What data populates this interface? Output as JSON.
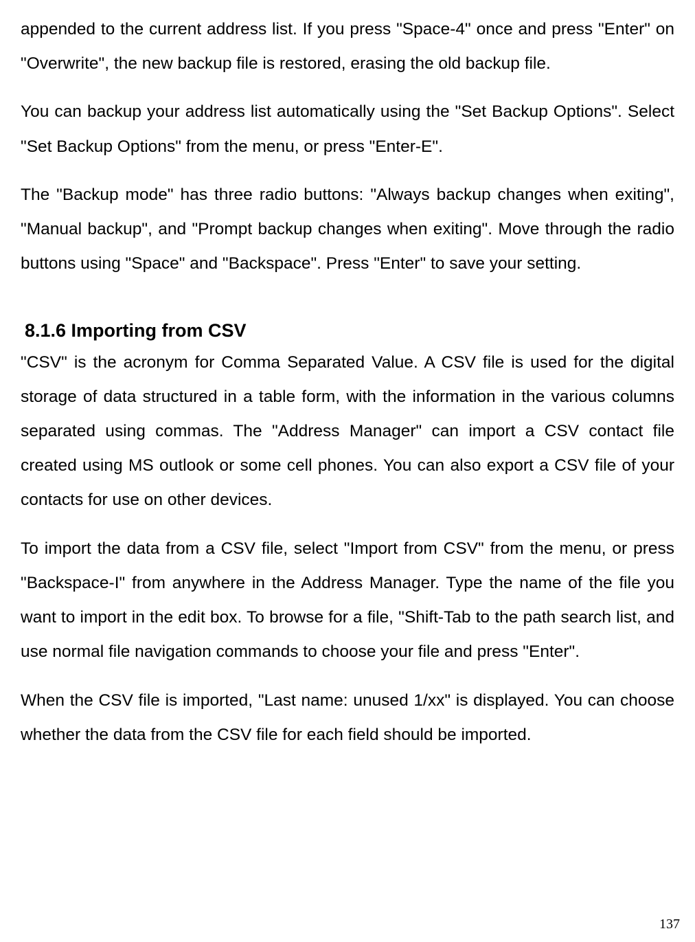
{
  "paragraphs": {
    "p1": "appended to the current address list. If you press \"Space-4\" once and press \"Enter\" on \"Overwrite\", the new backup file is restored, erasing the old backup file.",
    "p2": "You can backup your address list automatically using the \"Set Backup Options\". Select \"Set Backup Options\" from the menu, or press \"Enter-E\".",
    "p3": "The \"Backup mode\" has three radio buttons: \"Always backup changes when exiting\", \"Manual backup\", and \"Prompt backup changes when exiting\". Move through the radio buttons using \"Space\" and \"Backspace\". Press \"Enter\" to save your setting.",
    "heading": "8.1.6 Importing from CSV",
    "p4": "\"CSV\" is the acronym for Comma Separated Value. A CSV file is used for the digital storage of data structured in a table form, with the information in the various columns separated using commas. The \"Address Manager\" can import a CSV contact file created using MS outlook or some cell phones. You can also export a CSV file of your contacts for use on other devices.",
    "p5": "To import the data from a CSV file, select \"Import from CSV\" from the menu, or press \"Backspace-I\" from anywhere in the Address Manager. Type the name of the file you want to import in the edit box. To browse for a file, \"Shift-Tab to the path search list, and use normal file navigation commands to choose your file and press \"Enter\".",
    "p6": "When the CSV file is imported, \"Last name: unused 1/xx\" is displayed. You can choose whether the data from the CSV file for each field should be imported."
  },
  "page_number": "137"
}
